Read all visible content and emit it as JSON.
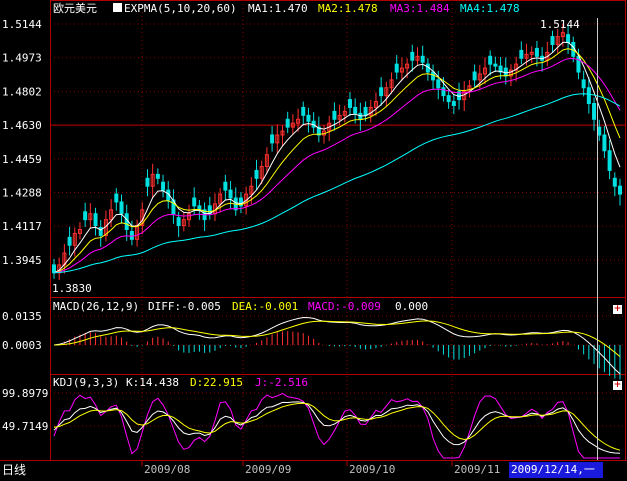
{
  "main_panel": {
    "symbol": "欧元美元",
    "indicator": "EXPMA(5,10,20,60)",
    "ma1": "MA1:1.470",
    "ma2": "MA2:1.478",
    "ma3": "MA3:1.484",
    "ma4": "MA4:1.478",
    "y_ticks": [
      "1.5144",
      "1.4973",
      "1.4802",
      "1.4630",
      "1.4459",
      "1.4288",
      "1.4117",
      "1.3945"
    ],
    "high_label": "1.5144",
    "low_label": "1.3830"
  },
  "macd_panel": {
    "title": "MACD(26,12,9)",
    "diff": "DIFF:-0.005",
    "dea": "DEA:-0.001",
    "macd": "MACD:-0.009",
    "extra": "0.000",
    "y_ticks": [
      "0.0135",
      "0.0003"
    ]
  },
  "kdj_panel": {
    "title": "KDJ(9,3,3)",
    "k": "K:14.438",
    "d": "D:22.915",
    "j": "J:-2.516",
    "y_ticks": [
      "99.8979",
      "49.7149"
    ]
  },
  "x_axis": {
    "period_label": "日线",
    "months": [
      "2009/08",
      "2009/09",
      "2009/10",
      "2009/11"
    ],
    "cursor_date": "2009/12/14,一"
  },
  "colors": {
    "up": "#ff3030",
    "down": "#00e0e0",
    "ma1": "#ffffff",
    "ma2": "#ffff00",
    "ma3": "#ff00ff",
    "ma4": "#00ffff",
    "grid": "#8b0000"
  },
  "chart_data": {
    "type": "candlestick",
    "price_range": [
      1.383,
      1.5144
    ],
    "high_value": 1.5144,
    "low_value": 1.383,
    "closes_approx": [
      1.388,
      1.392,
      1.398,
      1.402,
      1.408,
      1.41,
      1.415,
      1.418,
      1.412,
      1.407,
      1.415,
      1.42,
      1.424,
      1.418,
      1.41,
      1.405,
      1.412,
      1.42,
      1.432,
      1.438,
      1.436,
      1.43,
      1.425,
      1.418,
      1.412,
      1.415,
      1.418,
      1.422,
      1.42,
      1.415,
      1.418,
      1.423,
      1.428,
      1.43,
      1.426,
      1.42,
      1.422,
      1.428,
      1.432,
      1.436,
      1.442,
      1.448,
      1.454,
      1.458,
      1.46,
      1.462,
      1.464,
      1.466,
      1.468,
      1.465,
      1.462,
      1.458,
      1.46,
      1.464,
      1.466,
      1.468,
      1.47,
      1.472,
      1.469,
      1.466,
      1.468,
      1.472,
      1.475,
      1.478,
      1.482,
      1.486,
      1.49,
      1.492,
      1.494,
      1.496,
      1.498,
      1.495,
      1.49,
      1.486,
      1.482,
      1.478,
      1.475,
      1.473,
      1.476,
      1.48,
      1.483,
      1.486,
      1.489,
      1.492,
      1.494,
      1.493,
      1.49,
      1.488,
      1.491,
      1.494,
      1.497,
      1.499,
      1.5,
      1.498,
      1.496,
      1.5,
      1.504,
      1.508,
      1.51,
      1.505,
      1.498,
      1.49,
      1.482,
      1.474,
      1.466,
      1.458,
      1.45,
      1.44,
      1.432,
      1.428
    ]
  }
}
